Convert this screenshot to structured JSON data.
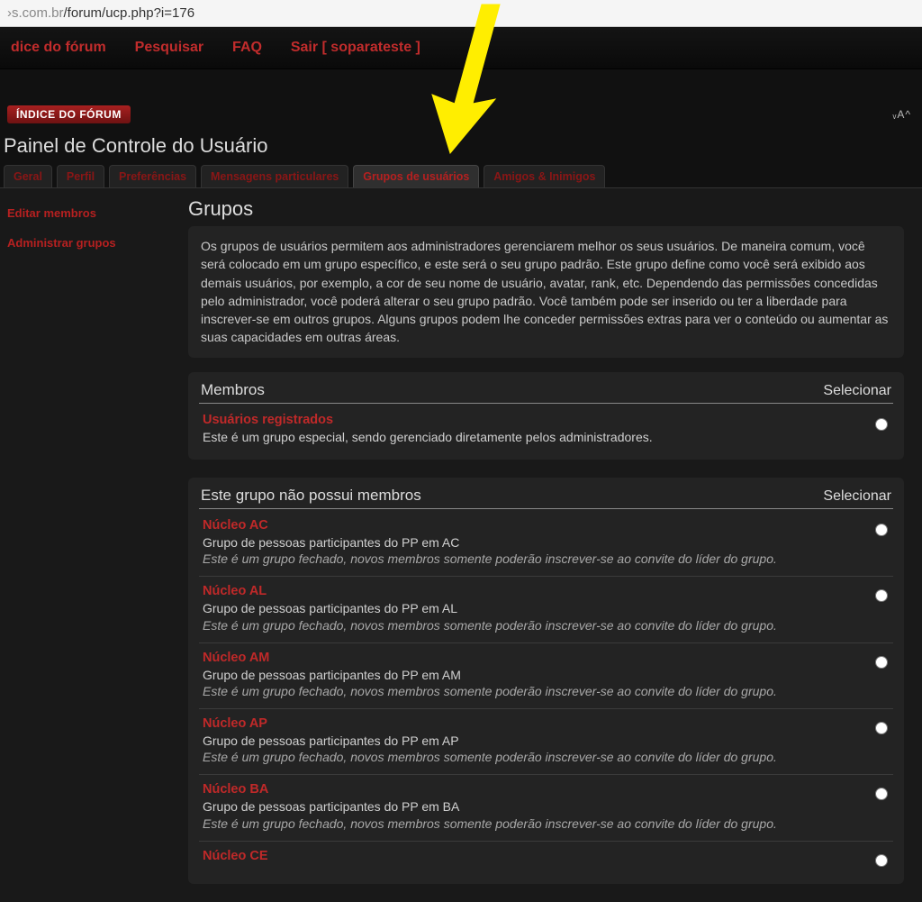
{
  "url": {
    "host": "›s.com.br",
    "path": "/forum/ucp.php?i=176"
  },
  "nav": {
    "index": "dice do fórum",
    "search": "Pesquisar",
    "faq": "FAQ",
    "logout": "Sair [ soparateste ]"
  },
  "breadcrumb": "ÍNDICE DO FÓRUM",
  "font_ctrl": "ᵥA^",
  "panel_title": "Painel de Controle do Usuário",
  "tabs": {
    "general": "Geral",
    "profile": "Perfil",
    "prefs": "Preferências",
    "pm": "Mensagens particulares",
    "groups": "Grupos de usuários",
    "friends": "Amigos & Inimigos"
  },
  "side": {
    "edit_members": "Editar membros",
    "manage_groups": "Administrar grupos"
  },
  "content": {
    "title": "Grupos",
    "desc": "Os grupos de usuários permitem aos administradores gerenciarem melhor os seus usuários. De maneira comum, você será colocado em um grupo específico, e este será o seu grupo padrão. Este grupo define como você será exibido aos demais usuários, por exemplo, a cor de seu nome de usuário, avatar, rank, etc. Dependendo das permissões concedidas pelo administrador, você poderá alterar o seu grupo padrão. Você também pode ser inserido ou ter a liberdade para inscrever-se em outros grupos. Alguns grupos podem lhe conceder permissões extras para ver o conteúdo ou aumentar as suas capacidades em outras áreas.",
    "members_hdr": "Membros",
    "select_hdr": "Selecionar",
    "nonmembers_hdr": "Este grupo não possui membros",
    "registered": {
      "name": "Usuários registrados",
      "desc": "Este é um grupo especial, sendo gerenciado diretamente pelos administradores."
    },
    "groups": [
      {
        "name": "Núcleo AC",
        "desc": "Grupo de pessoas participantes do PP em AC",
        "note": "Este é um grupo fechado, novos membros somente poderão inscrever-se ao convite do líder do grupo."
      },
      {
        "name": "Núcleo AL",
        "desc": "Grupo de pessoas participantes do PP em AL",
        "note": "Este é um grupo fechado, novos membros somente poderão inscrever-se ao convite do líder do grupo."
      },
      {
        "name": "Núcleo AM",
        "desc": "Grupo de pessoas participantes do PP em AM",
        "note": "Este é um grupo fechado, novos membros somente poderão inscrever-se ao convite do líder do grupo."
      },
      {
        "name": "Núcleo AP",
        "desc": "Grupo de pessoas participantes do PP em AP",
        "note": "Este é um grupo fechado, novos membros somente poderão inscrever-se ao convite do líder do grupo."
      },
      {
        "name": "Núcleo BA",
        "desc": "Grupo de pessoas participantes do PP em BA",
        "note": "Este é um grupo fechado, novos membros somente poderão inscrever-se ao convite do líder do grupo."
      },
      {
        "name": "Núcleo CE",
        "desc": "",
        "note": ""
      }
    ]
  }
}
